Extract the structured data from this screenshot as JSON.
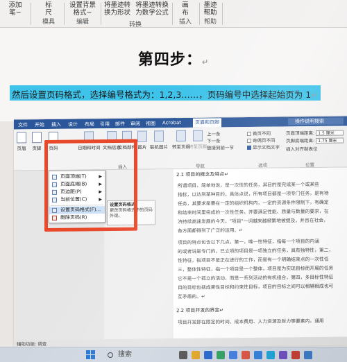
{
  "ribbon_top": {
    "groups": [
      {
        "lines": [
          "添加",
          "笔~"
        ],
        "name": ""
      },
      {
        "lines": [
          "标",
          "尺"
        ],
        "name": "模具"
      },
      {
        "lines": [
          "设置背景",
          "格式~"
        ],
        "name": "编辑"
      },
      {
        "lines": [
          "将墨迹转",
          "换为形状"
        ],
        "name": ""
      },
      {
        "lines": [
          "将墨迹转换",
          "为数学公式"
        ],
        "name": "转换"
      },
      {
        "lines": [
          "画",
          "布"
        ],
        "name": "插入"
      },
      {
        "lines": [
          "墨迹",
          "帮助"
        ],
        "name": "帮助"
      }
    ]
  },
  "document": {
    "title": "第四步：",
    "highlighted_text": "然后设置页码格式，选择编号格式为：1,2,3……，页码编号中选择起始页为 1",
    "para_mark": "↵"
  },
  "embedded": {
    "tabs": [
      "文件",
      "开始",
      "插入",
      "设计",
      "布局",
      "引用",
      "邮件",
      "审阅",
      "视图",
      "Acrobat",
      "页眉和页脚"
    ],
    "active_tab": "页眉和页脚",
    "search": "操作说明搜索",
    "ribbon": {
      "header_btn": "页眉",
      "footer_btn": "页脚",
      "page_number_btn": "页码",
      "datetime_btn": "日期和时间",
      "docinfo_btn": "文档信息",
      "docparts_btn": "文档部件",
      "picture_btn": "图片",
      "online_picture_btn": "联机图片",
      "goto_header_btn": "转至页眉",
      "goto_footer_btn": "转至页脚",
      "prev_btn": "上一条",
      "next_btn": "下一条",
      "link_prev_btn": "链接到前一节",
      "nav_group": "导航",
      "insert_group": "插入",
      "option_first_page": "首页不同",
      "option_odd_even": "奇偶页不同",
      "option_show_text": "显示文档文字",
      "options_group": "选项",
      "header_top_label": "页眉顶端距离:",
      "header_top_value": "1.5 厘米",
      "footer_bottom_label": "页脚底端距离:",
      "footer_bottom_value": "1.75 厘米",
      "insert_align_tab": "插入对齐制表位",
      "position_group": "位置"
    },
    "menu": {
      "items": [
        "页面顶端(T)",
        "页面底端(B)",
        "页边距(P)",
        "当前位置(C)",
        "设置页码格式(F)...",
        "删除页码(R)"
      ]
    },
    "tooltip": {
      "title": "设置页码格式",
      "body": "更改页码格式中的页码外观。"
    },
    "body": {
      "heading1": "2.1 项目的概念及特点↵",
      "lines": [
        "所谓项目，简单地说，是一次性的任务，其目的是完成某一个或某些",
        "指标，以达到某种目的。具体点说，所有项目都是一项专门任务，是有待",
        "任务，其要求是要在一定的组织机构内，一定的资源条件限制下，有确定",
        "和结束时间里完成的一次性任务，并要满足性能、质量与数量的要求，在",
        "济持续高速发展的今天，\"项目\"一词越来越频繁地被提及，并且在社会，",
        "各方面都得到了广泛的运用。↵",
        "项目的特点包含以下几点，第一，唯一性特征，指每一个项目的内涵",
        "的或者说是专门的，已立项的项目是一项独立的任务，具有独特性，第二，",
        "性特征，指项目不是正在进行的工作，而是有一个明确结束点的一次性任",
        "三，整体性特征，指一个项目是一个整体，项目是为实现目标而开展的任务",
        "它不是一个孤立的活动，而是一系列活动的有机组合，第四，多目标性特征",
        "目的目标包括成果性目标和约束性目标，项目的目标之间可以相辅相成也可",
        "互矛盾的。↵"
      ],
      "heading2": "2.2 项目开发的界定↵",
      "last_line": "项目开发即在限定的时间、成本费用、人力资源及财力等要素内，通用"
    },
    "status": "辅助功能: 调查"
  },
  "taskbar": {
    "search_placeholder": "搜索"
  }
}
